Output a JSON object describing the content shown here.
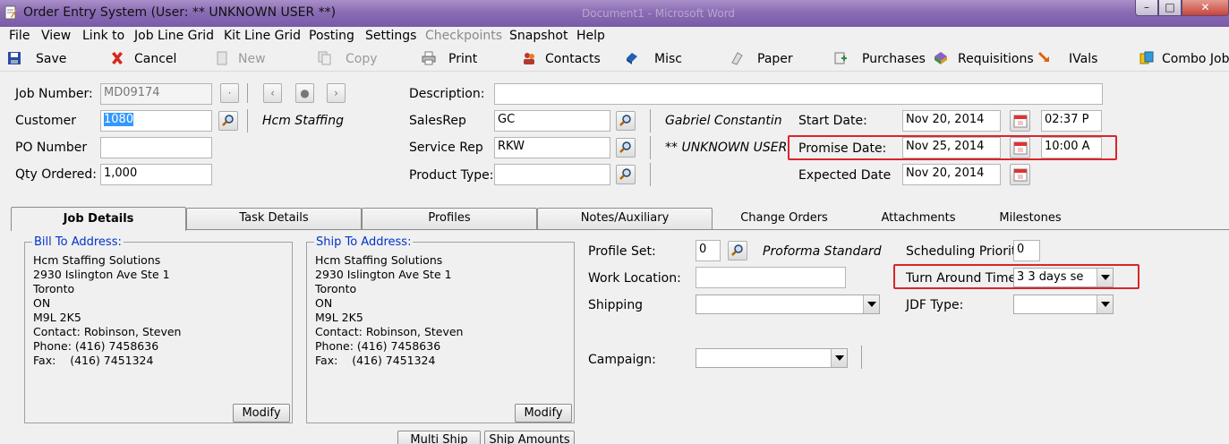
{
  "window": {
    "title": "Order Entry System   (User: ** UNKNOWN USER **)",
    "background_doc": "Document1 - Microsoft Word",
    "min_glyph": "–",
    "max_glyph": "□",
    "close_glyph": "✕"
  },
  "menu": [
    "File",
    "View",
    "Link to",
    "Job Line Grid",
    "Kit Line Grid",
    "Posting",
    "Settings",
    "Checkpoints",
    "Snapshot",
    "Help"
  ],
  "toolbar": {
    "save": "Save",
    "cancel": "Cancel",
    "new": "New",
    "copy": "Copy",
    "print": "Print",
    "contacts": "Contacts",
    "misc": "Misc",
    "paper": "Paper",
    "purchases": "Purchases",
    "requisitions": "Requisitions",
    "ivals": "IVals",
    "combo_job": "Combo Job"
  },
  "header": {
    "job_number_label": "Job Number:",
    "job_number": "MD09174",
    "customer_label": "Customer",
    "customer": "1080",
    "customer_name": "Hcm Staffing",
    "po_label": "PO Number",
    "po_number": "",
    "qty_label": "Qty Ordered:",
    "qty": "1,000",
    "description_label": "Description:",
    "description": "",
    "salesrep_label": "SalesRep",
    "salesrep": "GC",
    "salesrep_name": "Gabriel Constantin",
    "servicerep_label": "Service Rep",
    "servicerep": "RKW",
    "servicerep_name": "** UNKNOWN USER",
    "producttype_label": "Product Type:",
    "producttype": "",
    "start_label": "Start Date:",
    "start_date": "Nov 20, 2014",
    "start_time": "02:37 P",
    "promise_label": "Promise Date:",
    "promise_date": "Nov 25, 2014",
    "promise_time": "10:00 A",
    "expected_label": "Expected Date",
    "expected_date": "Nov 20, 2014",
    "nav_first": "‹",
    "nav_mid": "●",
    "nav_next": "›",
    "nav_dot": "·"
  },
  "tabs": [
    "Job Details",
    "Task Details",
    "Profiles",
    "Notes/Auxiliary",
    "Change Orders",
    "Attachments",
    "Milestones"
  ],
  "bill_to": {
    "title": "Bill To Address:",
    "lines": "Hcm Staffing Solutions\n2930 Islington Ave Ste 1\nToronto\nON\nM9L 2K5\nContact: Robinson, Steven\nPhone: (416) 7458636\nFax:    (416) 7451324",
    "modify": "Modify"
  },
  "ship_to": {
    "title": "Ship To Address:",
    "lines": "Hcm Staffing Solutions\n2930 Islington Ave Ste 1\nToronto\nON\nM9L 2K5\nContact: Robinson, Steven\nPhone: (416) 7458636\nFax:    (416) 7451324",
    "modify": "Modify"
  },
  "buttons": {
    "multi_ship": "Multi Ship",
    "ship_amounts": "Ship Amounts"
  },
  "details": {
    "profile_set_label": "Profile Set:",
    "profile_set": "0",
    "profile_set_name": "Proforma Standard",
    "work_location_label": "Work Location:",
    "work_location": "",
    "shipping_label": "Shipping",
    "shipping": "",
    "campaign_label": "Campaign:",
    "campaign": "",
    "scheduling_label": "Scheduling Priority:",
    "scheduling": "0",
    "turnaround_label": "Turn Around Time:",
    "turnaround": "3      3 days se",
    "jdf_label": "JDF Type:",
    "jdf": ""
  },
  "colors": {
    "highlight_box": "#d9252a",
    "group_title": "#0033cc",
    "selection": "#3399ff"
  }
}
